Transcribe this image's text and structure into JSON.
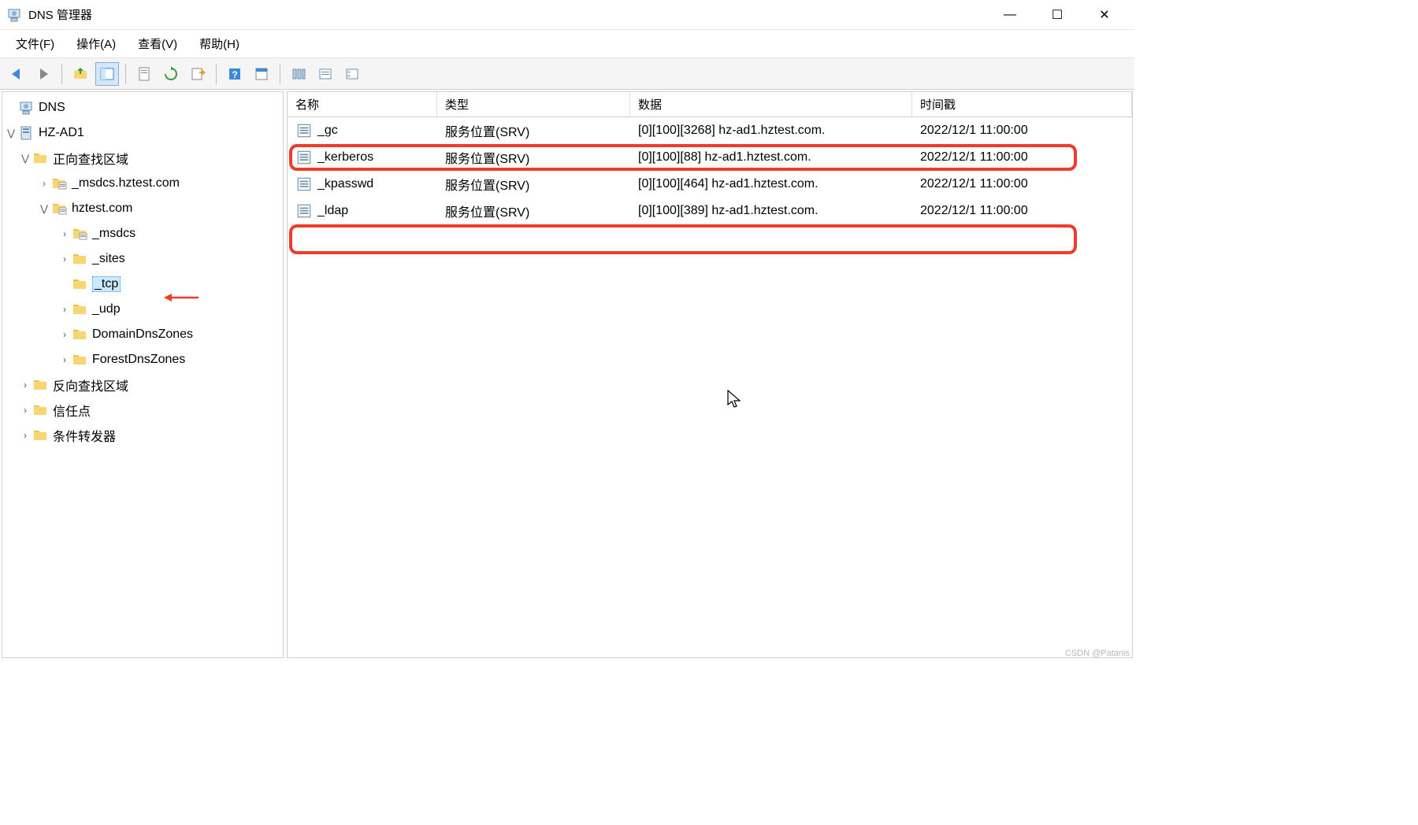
{
  "window": {
    "title": "DNS 管理器"
  },
  "menu": {
    "file": "文件(F)",
    "action": "操作(A)",
    "view": "查看(V)",
    "help": "帮助(H)"
  },
  "tree": {
    "root": "DNS",
    "server": "HZ-AD1",
    "fwd_zone": "正向查找区域",
    "zone_msdcs": "_msdcs.hztest.com",
    "zone_main": "hztest.com",
    "sub_msdcs": "_msdcs",
    "sub_sites": "_sites",
    "sub_tcp": "_tcp",
    "sub_udp": "_udp",
    "sub_ddz": "DomainDnsZones",
    "sub_fdz": "ForestDnsZones",
    "rev_zone": "反向查找区域",
    "trust": "信任点",
    "cond_fwd": "条件转发器"
  },
  "columns": {
    "name": "名称",
    "type": "类型",
    "data": "数据",
    "timestamp": "时间戳"
  },
  "records": [
    {
      "name": "_gc",
      "type": "服务位置(SRV)",
      "data": "[0][100][3268] hz-ad1.hztest.com.",
      "ts": "2022/12/1 11:00:00"
    },
    {
      "name": "_kerberos",
      "type": "服务位置(SRV)",
      "data": "[0][100][88] hz-ad1.hztest.com.",
      "ts": "2022/12/1 11:00:00"
    },
    {
      "name": "_kpasswd",
      "type": "服务位置(SRV)",
      "data": "[0][100][464] hz-ad1.hztest.com.",
      "ts": "2022/12/1 11:00:00"
    },
    {
      "name": "_ldap",
      "type": "服务位置(SRV)",
      "data": "[0][100][389] hz-ad1.hztest.com.",
      "ts": "2022/12/1 11:00:00"
    }
  ],
  "watermark": "CSDN @Patanis"
}
